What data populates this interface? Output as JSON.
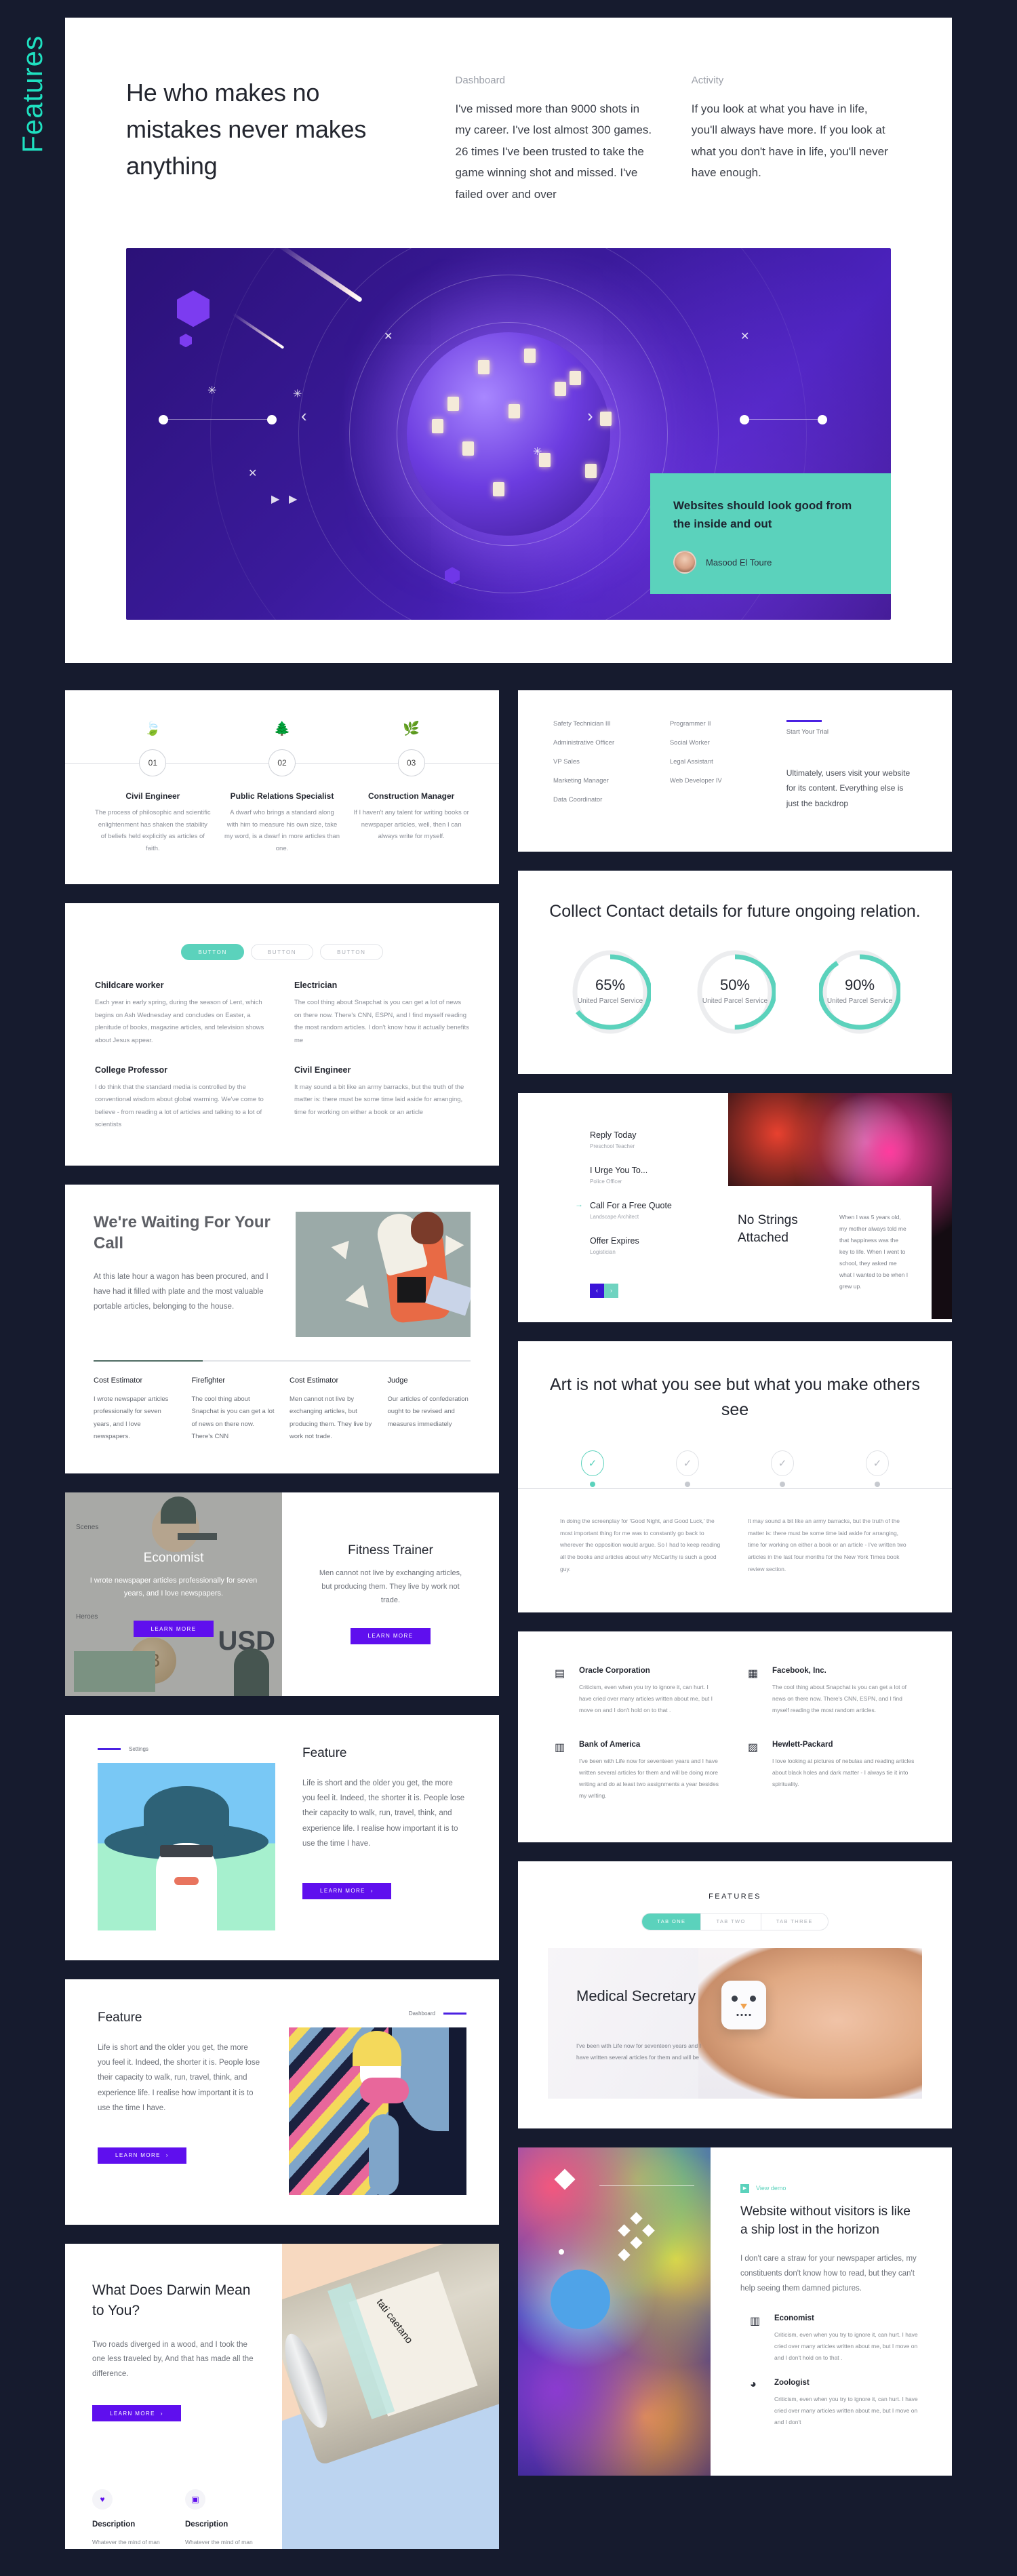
{
  "sidebar": {
    "label": "Features"
  },
  "hero": {
    "headline": "He who makes no mistakes never makes anything",
    "col1": {
      "kicker": "Dashboard",
      "body": "I've missed more than 9000 shots in my career. I've lost almost 300 games. 26 times I've been trusted to take the game winning shot and missed. I've failed over and over"
    },
    "col2": {
      "kicker": "Activity",
      "body": "If you look at what you have in life, you'll always have more. If you look at what you don't have in life, you'll never have enough."
    },
    "quote": {
      "text": "Websites should look good from the inside and out",
      "author": "Masood El Toure"
    },
    "nav": {
      "prev": "‹",
      "next": "›"
    }
  },
  "timeline": {
    "steps": [
      {
        "num": "01",
        "icon": "🍃",
        "title": "Civil Engineer",
        "body": "The process of philosophic and scientific enlightenment has shaken the stability of beliefs held explicitly as articles of faith."
      },
      {
        "num": "02",
        "icon": "🌲",
        "title": "Public Relations Specialist",
        "body": "A dwarf who brings a standard along with him to measure his own size, take my word, is a dwarf in more articles than one."
      },
      {
        "num": "03",
        "icon": "🌿",
        "title": "Construction Manager",
        "body": "If I haven't any talent for writing books or newspaper articles, well, then I can always write for myself."
      }
    ]
  },
  "jobs": {
    "col1": [
      "Safety Technician III",
      "Administrative Officer",
      "VP Sales",
      "Marketing Manager",
      "Data Coordinator"
    ],
    "col2": [
      "Programmer II",
      "Social Worker",
      "Legal Assistant",
      "Web Developer IV"
    ],
    "trial_label": "Start Your Trial",
    "trial_body": "Ultimately, users visit your website for its content. Everything else is just the backdrop"
  },
  "stats": {
    "title": "Collect Contact details for future ongoing relation.",
    "items": [
      {
        "pct": "65%",
        "value": 65,
        "label": "United Parcel Service"
      },
      {
        "pct": "50%",
        "value": 50,
        "label": "United Parcel Service"
      },
      {
        "pct": "90%",
        "value": 90,
        "label": "United Parcel Service"
      }
    ],
    "accent": "#5BD2BC"
  },
  "tabs": {
    "pills": [
      "BUTTON",
      "BUTTON",
      "BUTTON"
    ],
    "active_index": 0,
    "items": [
      {
        "title": "Childcare worker",
        "body": "Each year in early spring, during the season of Lent, which begins on Ash Wednesday and concludes on Easter, a plenitude of books, magazine articles, and television shows about Jesus appear."
      },
      {
        "title": "Electrician",
        "body": "The cool thing about Snapchat is you can get a lot of news on there now. There's CNN, ESPN, and I find myself reading the most random articles. I don't know how it actually benefits me"
      },
      {
        "title": "College Professor",
        "body": "I do think that the standard media is controlled by the conventional wisdom about global warming. We've come to believe - from reading a lot of articles and talking to a lot of scientists"
      },
      {
        "title": "Civil Engineer",
        "body": "It may sound a bit like an army barracks, but the truth of the matter is: there must be some time laid aside for arranging, time for working on either a book or an article"
      }
    ]
  },
  "waiting": {
    "title": "We're Waiting For Your Call",
    "body": "At this late hour a wagon has been procured, and I have had it filled with plate and the most valuable portable articles, belonging to the house.",
    "cards": [
      {
        "title": "Cost Estimator",
        "body": "I wrote newspaper articles professionally for seven years, and I love newspapers."
      },
      {
        "title": "Firefighter",
        "body": "The cool thing about Snapchat is you can get a lot of news on there now. There's CNN"
      },
      {
        "title": "Cost Estimator",
        "body": "Men cannot not live by exchanging articles, but producing them. They live by work not trade."
      },
      {
        "title": "Judge",
        "body": "Our articles of confederation ought to be revised and measures immediately"
      }
    ]
  },
  "strings": {
    "list": [
      {
        "title": "Reply Today",
        "sub": "Preschool Teacher",
        "active": false
      },
      {
        "title": "I Urge You To...",
        "sub": "Police Officer",
        "active": false
      },
      {
        "title": "Call For a Free Quote",
        "sub": "Landscape Architect",
        "active": true
      },
      {
        "title": "Offer Expires",
        "sub": "Logistician",
        "active": false
      }
    ],
    "nav": {
      "prev": "‹",
      "next": "›"
    },
    "card_title": "No Strings Attached",
    "card_body": "When I was 5 years old, my mother always told me that happiness was the key to life. When I went to school, they asked me what I wanted to be when I grew up."
  },
  "economist": {
    "left": {
      "title": "Economist",
      "body": "I wrote newspaper articles professionally for seven years, and I love newspapers.",
      "button": "LEARN MORE",
      "scenes": "Scenes",
      "heroes": "Heroes",
      "usd": "USD"
    },
    "right": {
      "title": "Fitness Trainer",
      "body": "Men cannot not live by exchanging articles, but producing them. They live by work not trade.",
      "button": "LEARN MORE"
    }
  },
  "art": {
    "title": "Art is not what you see but what you make others see",
    "steps": 4,
    "active_step": 0,
    "check": "✓",
    "texts": [
      "In doing the screenplay for 'Good Night, and Good Luck,' the most important thing for me was to constantly go back to wherever the opposition would argue. So I had to keep reading all the books and articles about why McCarthy is such a good guy.",
      "It may sound a bit like an army barracks, but the truth of the matter is: there must be some time laid aside for arranging, time for working on either a book or an article - I've written two articles in the last four months for the New York Times book review section."
    ]
  },
  "features": [
    {
      "kicker": "Settings",
      "title": "Feature",
      "body": "Life is short and the older you get, the more you feel it. Indeed, the shorter it is. People lose their capacity to walk, run, travel, think, and experience life. I realise how important it is to use the time I have.",
      "button": "LEARN MORE",
      "arrow": "›",
      "reversed": false
    },
    {
      "kicker": "Dashboard",
      "title": "Feature",
      "body": "Life is short and the older you get, the more you feel it. Indeed, the shorter it is. People lose their capacity to walk, run, travel, think, and experience life. I realise how important it is to use the time I have.",
      "button": "LEARN MORE",
      "arrow": "›",
      "reversed": true
    }
  ],
  "companies": [
    {
      "icon": "list-icon",
      "glyph": "▤",
      "name": "Oracle Corporation",
      "body": "Criticism, even when you try to ignore it, can hurt. I have cried over many articles written about me, but I move on and I don't hold on to that ."
    },
    {
      "icon": "window-icon",
      "glyph": "▦",
      "name": "Facebook, Inc.",
      "body": "The cool thing about Snapchat is you can get a lot of news on there now. There's CNN, ESPN, and I find myself reading the most random articles."
    },
    {
      "icon": "calendar-icon",
      "glyph": "▥",
      "name": "Bank of America",
      "body": "I've been with Life now for seventeen years and I have written several articles for them and will be doing more writing and do at least two assignments a year besides my writing."
    },
    {
      "icon": "keypad-icon",
      "glyph": "▨",
      "name": "Hewlett-Packard",
      "body": "I love looking at pictures of nebulas and reading articles about black holes and dark matter - I always tie it into spirituality."
    }
  ],
  "medical": {
    "eyebrow": "FEATURES",
    "tabs": [
      "TAB ONE",
      "TAB TWO",
      "TAB THREE"
    ],
    "active_tab": 0,
    "title": "Medical Secretary",
    "body": "I've been with Life now for seventeen years and I have written several articles for them and will be"
  },
  "darwin": {
    "title": "What Does Darwin Mean to You?",
    "body": "Two roads diverged in a wood, and I took the one less traveled by, And that has made all the difference.",
    "button": "LEARN MORE",
    "arrow": "›",
    "features": [
      {
        "glyph": "♥",
        "icon": "heart-icon",
        "title": "Description",
        "body": "Whatever the mind of man can conceive and believe, it can achieve."
      },
      {
        "glyph": "▣",
        "icon": "calendar-icon",
        "title": "Description",
        "body": "Whatever the mind of man can conceive and believe, it can achieve."
      }
    ],
    "image_label": "tati caetano"
  },
  "website": {
    "view_demo": "View demo",
    "play": "▶",
    "title": "Website without visitors is like a ship lost in the horizon",
    "body": "I don't care a straw for your newspaper articles, my constituents don't know how to read, but they can't help seeing them damned pictures.",
    "items": [
      {
        "glyph": "▥",
        "icon": "grid-icon",
        "name": "Economist",
        "body": "Criticism, even when you try to ignore it, can hurt. I have cried over many articles written about me, but I move on and I don't hold on to that ."
      },
      {
        "glyph": "◕",
        "icon": "pie-chart-icon",
        "name": "Zoologist",
        "body": "Criticism, even when you try to ignore it, can hurt. I have cried over many articles written about me, but I move on and I don't"
      }
    ]
  }
}
